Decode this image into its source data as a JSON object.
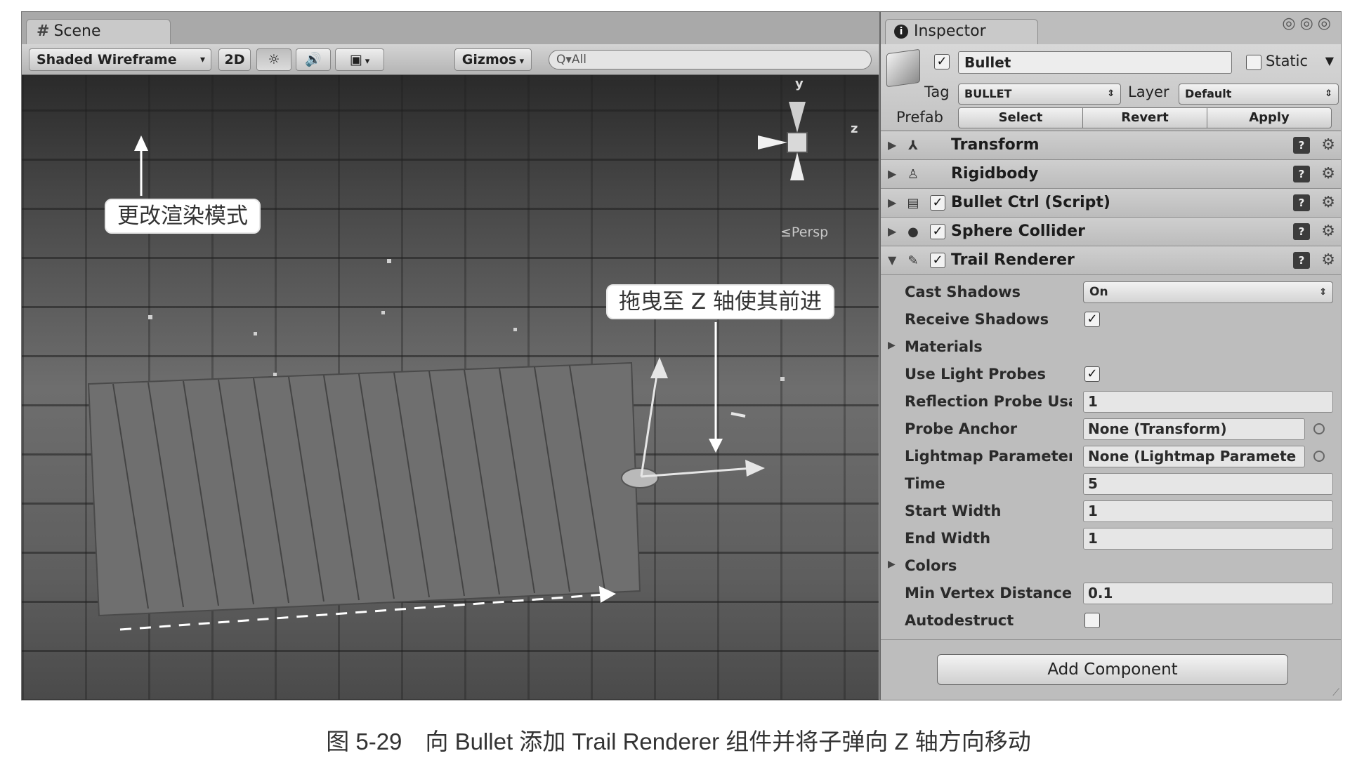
{
  "scene": {
    "tab_label": "Scene",
    "render_mode": "Shaded Wireframe",
    "btn_2d": "2D",
    "light_icon": "sun-icon",
    "audio_icon": "speaker-icon",
    "effects_icon": "image-icon",
    "gizmos_label": "Gizmos",
    "search_placeholder": "Q▾All",
    "persp_label": "≤Persp",
    "axis_y": "y",
    "axis_z": "z"
  },
  "callouts": {
    "render_mode_note": "更改渲染模式",
    "drag_note": "拖曳至 Z 轴使其前进"
  },
  "inspector": {
    "tab_label": "Inspector",
    "object_name": "Bullet",
    "active_checked": true,
    "static_label": "Static",
    "static_checked": false,
    "tag_label": "Tag",
    "tag_value": "BULLET",
    "layer_label": "Layer",
    "layer_value": "Default",
    "prefab_label": "Prefab",
    "prefab_select": "Select",
    "prefab_revert": "Revert",
    "prefab_apply": "Apply",
    "components": [
      {
        "name": "Transform",
        "icon": "transform-icon",
        "has_checkbox": false,
        "checked": false,
        "expanded": false
      },
      {
        "name": "Rigidbody",
        "icon": "rigidbody-icon",
        "has_checkbox": false,
        "checked": false,
        "expanded": false
      },
      {
        "name": "Bullet Ctrl (Script)",
        "icon": "script-icon",
        "has_checkbox": true,
        "checked": true,
        "expanded": false
      },
      {
        "name": "Sphere Collider",
        "icon": "sphere-icon",
        "has_checkbox": true,
        "checked": true,
        "expanded": false
      },
      {
        "name": "Trail Renderer",
        "icon": "trail-icon",
        "has_checkbox": true,
        "checked": true,
        "expanded": true
      }
    ],
    "trail_properties": {
      "cast_shadows": {
        "label": "Cast Shadows",
        "value": "On"
      },
      "receive_shadows": {
        "label": "Receive Shadows",
        "checked": true
      },
      "materials": {
        "label": "Materials"
      },
      "use_light_probes": {
        "label": "Use Light Probes",
        "checked": true
      },
      "reflection_probe": {
        "label": "Reflection Probe Usa",
        "value": "1"
      },
      "probe_anchor": {
        "label": "Probe Anchor",
        "value": "None (Transform)"
      },
      "lightmap_params": {
        "label": "Lightmap Parameters",
        "value": "None (Lightmap Paramete"
      },
      "time": {
        "label": "Time",
        "value": "5"
      },
      "start_width": {
        "label": "Start Width",
        "value": "1"
      },
      "end_width": {
        "label": "End Width",
        "value": "1"
      },
      "colors": {
        "label": "Colors"
      },
      "min_vertex_distance": {
        "label": "Min Vertex Distance",
        "value": "0.1"
      },
      "autodestruct": {
        "label": "Autodestruct",
        "checked": false
      }
    },
    "add_component": "Add Component"
  },
  "caption": "图 5-29　向 Bullet 添加 Trail Renderer 组件并将子弹向 Z 轴方向移动"
}
